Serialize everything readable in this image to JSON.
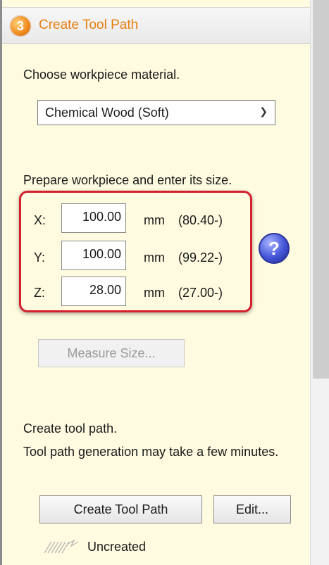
{
  "header": {
    "step": "3",
    "title": "Create Tool Path"
  },
  "material": {
    "label": "Choose workpiece material.",
    "selected": "Chemical Wood (Soft)"
  },
  "workpiece": {
    "label": "Prepare workpiece and enter its size.",
    "x": {
      "axis": "X:",
      "value": "100.00",
      "unit": "mm",
      "range": "(80.40-)"
    },
    "y": {
      "axis": "Y:",
      "value": "100.00",
      "unit": "mm",
      "range": "(99.22-)"
    },
    "z": {
      "axis": "Z:",
      "value": "28.00",
      "unit": "mm",
      "range": "(27.00-)"
    },
    "help": "?"
  },
  "measure_button": "Measure Size...",
  "toolpath": {
    "label": "Create tool path.",
    "note": "Tool path generation may take a few minutes.",
    "create_button": "Create Tool Path",
    "edit_button": "Edit...",
    "status": "Uncreated"
  },
  "colors": {
    "accent": "#e57f10",
    "highlight": "#d41f2e",
    "panel": "#fefbe0"
  }
}
